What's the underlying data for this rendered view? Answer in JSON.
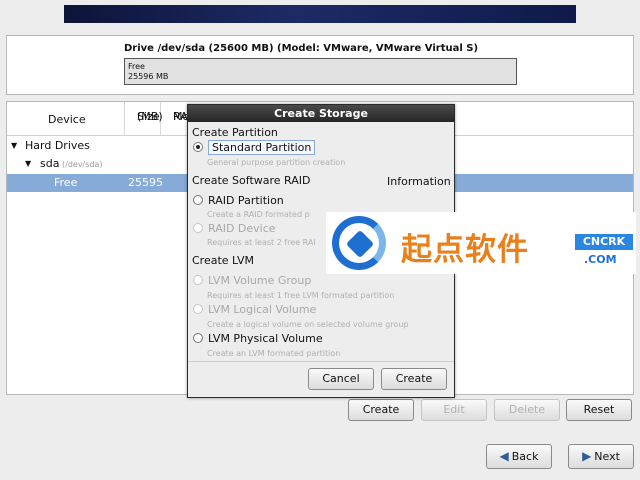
{
  "drive": {
    "title": "Drive /dev/sda (25600 MB) (Model: VMware, VMware Virtual S)",
    "bar_label": "Free",
    "bar_size": "25596 MB"
  },
  "device_table": {
    "headers": {
      "device": "Device",
      "size_line1": "Size",
      "size_line2": "(MB)",
      "mount_line1": "Mou",
      "mount_line2": "RAID"
    },
    "rows": [
      {
        "name": "Hard Drives"
      },
      {
        "name": "sda",
        "path": "(/dev/sda)"
      },
      {
        "name": "Free",
        "size": "25595"
      }
    ]
  },
  "dialog": {
    "title": "Create Storage",
    "sections": {
      "partition": "Create Partition",
      "raid": "Create Software RAID",
      "lvm": "Create LVM",
      "information": "Information"
    },
    "options": [
      {
        "label": "Standard Partition",
        "desc": "General purpose partition creation",
        "selected": true,
        "enabled": true
      },
      {
        "label": "RAID Partition",
        "desc": "Create a RAID formated p",
        "selected": false,
        "enabled": true
      },
      {
        "label": "RAID Device",
        "desc": "Requires at least 2 free RAI",
        "selected": false,
        "enabled": false
      },
      {
        "label": "LVM Volume Group",
        "desc": "Requires at least 1 free LVM formated partition",
        "selected": false,
        "enabled": false
      },
      {
        "label": "LVM Logical Volume",
        "desc": "Create a logical volume on selected volume group",
        "selected": false,
        "enabled": false
      },
      {
        "label": "LVM Physical Volume",
        "desc": "Create an LVM formated partition",
        "selected": false,
        "enabled": true
      }
    ],
    "buttons": {
      "cancel": "Cancel",
      "create": "Create"
    }
  },
  "toolbar": {
    "create": "Create",
    "edit": "Edit",
    "delete": "Delete",
    "reset": "Reset"
  },
  "nav": {
    "back": "Back",
    "next": "Next"
  },
  "watermark": {
    "text": "起点软件",
    "badge": "CNCRK",
    "domain": ".COM"
  }
}
